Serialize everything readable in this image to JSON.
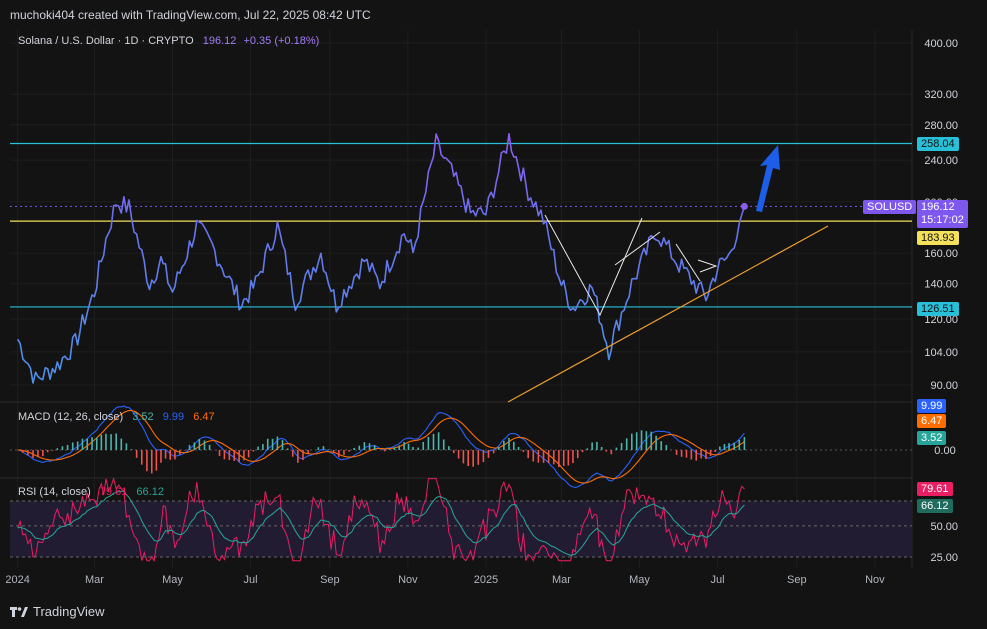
{
  "caption": "muchoki404 created with TradingView.com, Jul 22, 2025 08:42 UTC",
  "footer_logo": "TradingView",
  "symbol_header": {
    "name": "Solana / U.S. Dollar · 1D · CRYPTO",
    "price": "196.12",
    "change": "+0.35 (+0.18%)"
  },
  "price_tags": {
    "symbol": "SOLUSD",
    "last": "196.12",
    "countdown": "15:17:02",
    "level_yellow": "183.93",
    "level_top": "258.04",
    "level_bottom": "126.51"
  },
  "macd_header": {
    "label": "MACD (12, 26, close)",
    "hist": "3.52",
    "macd": "9.99",
    "signal": "6.47"
  },
  "macd_tags": {
    "macd": "9.99",
    "signal": "6.47",
    "hist": "3.52",
    "zero": "0.00"
  },
  "rsi_header": {
    "label": "RSI (14, close)",
    "rsi": "79.61",
    "ma": "66.12"
  },
  "rsi_tags": {
    "rsi": "79.61",
    "ma": "66.12",
    "upper": "70.00",
    "mid": "50.00",
    "lower": "25.00"
  },
  "colors": {
    "bg": "#131313",
    "line_low": "#4f8fe8",
    "line_high": "#8e5cf0",
    "cyan": "#27c0d8",
    "yellow": "#f4e05a",
    "orange": "#f0a030",
    "white": "#e8e8e8",
    "arrow": "#1c5ee8",
    "macd": "#2962ff",
    "signal": "#ff6d00",
    "hist_up": "#4db6ac",
    "hist_down": "#ef5350",
    "rsi": "#e91e63",
    "rsi_ma": "#26a69a",
    "rsi_band": "#221c33"
  },
  "chart_data": [
    {
      "type": "line",
      "title": "Solana / U.S. Dollar · 1D · CRYPTO",
      "scale": "log",
      "y_ticks": [
        90,
        104,
        120,
        140,
        160,
        183.93,
        200,
        240,
        280,
        320,
        400
      ],
      "x_ticks": [
        "2024",
        "Mar",
        "May",
        "Jul",
        "Sep",
        "Nov",
        "2025",
        "Mar",
        "May",
        "Jul",
        "Sep",
        "Nov"
      ],
      "ylim": [
        80,
        420
      ],
      "series": [
        {
          "name": "SOLUSD",
          "x": [
            "2024-01-01",
            "2024-01-15",
            "2024-02-01",
            "2024-02-15",
            "2024-03-01",
            "2024-03-10",
            "2024-03-18",
            "2024-03-28",
            "2024-04-13",
            "2024-04-22",
            "2024-05-01",
            "2024-05-20",
            "2024-06-01",
            "2024-06-24",
            "2024-07-05",
            "2024-07-22",
            "2024-08-05",
            "2024-08-25",
            "2024-09-06",
            "2024-09-28",
            "2024-10-10",
            "2024-10-29",
            "2024-11-05",
            "2024-11-23",
            "2024-12-05",
            "2024-12-20",
            "2025-01-01",
            "2025-01-19",
            "2025-02-03",
            "2025-02-15",
            "2025-03-01",
            "2025-03-10",
            "2025-03-25",
            "2025-04-07",
            "2025-04-25",
            "2025-05-14",
            "2025-06-01",
            "2025-06-22",
            "2025-07-01",
            "2025-07-10",
            "2025-07-22"
          ],
          "values": [
            110,
            92,
            98,
            108,
            135,
            170,
            200,
            195,
            140,
            155,
            135,
            180,
            165,
            128,
            140,
            180,
            130,
            160,
            128,
            155,
            140,
            175,
            160,
            258,
            228,
            190,
            190,
            265,
            210,
            185,
            140,
            126,
            138,
            105,
            140,
            176,
            152,
            132,
            150,
            158,
            196.12
          ]
        }
      ],
      "levels": [
        258.04,
        183.93,
        126.51
      ],
      "annotations": [
        "SOLUSD 196.12 15:17:02"
      ]
    },
    {
      "type": "line",
      "title": "MACD (12, 26, close)",
      "series": [
        {
          "name": "MACD",
          "last": 9.99
        },
        {
          "name": "Signal",
          "last": 6.47
        },
        {
          "name": "Histogram",
          "last": 3.52
        }
      ],
      "y_ticks": [
        0
      ]
    },
    {
      "type": "line",
      "title": "RSI (14, close)",
      "series": [
        {
          "name": "RSI",
          "last": 79.61
        },
        {
          "name": "RSI MA",
          "last": 66.12
        }
      ],
      "y_ticks": [
        25,
        50,
        70
      ],
      "ylim": [
        20,
        90
      ]
    }
  ]
}
